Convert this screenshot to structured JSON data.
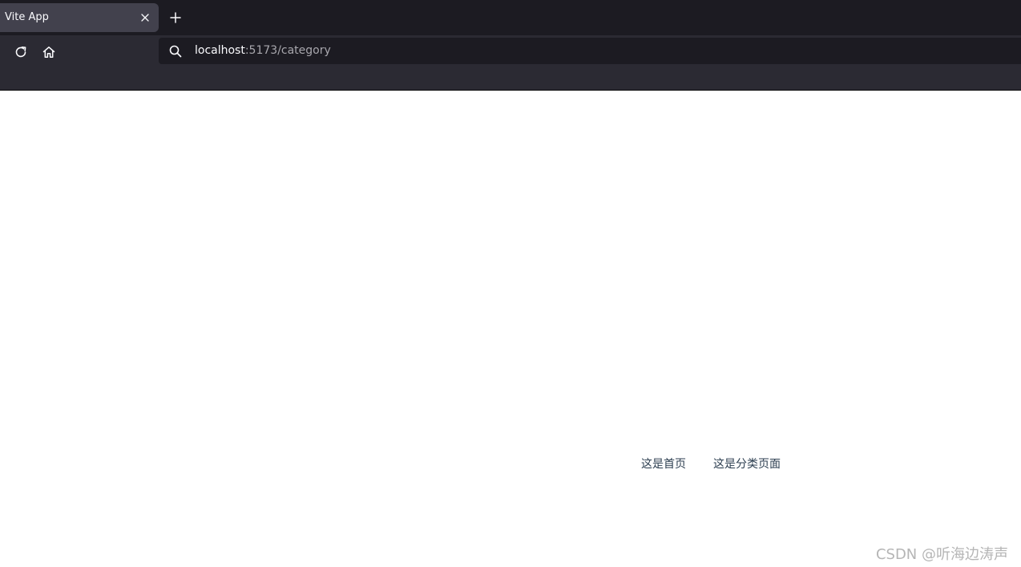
{
  "browser": {
    "tab": {
      "title": "Vite App"
    },
    "urlbar": {
      "host": "localhost",
      "rest": ":5173/category"
    },
    "icons": {
      "tab_close": "close-icon",
      "new_tab": "plus-icon",
      "reload": "reload-icon",
      "home": "home-icon",
      "search": "search-icon"
    },
    "colors": {
      "tab_strip": "#1c1b22",
      "toolbar": "#2b2a33",
      "active_tab": "#42414d",
      "urlbar": "#1c1b22"
    }
  },
  "page": {
    "nav": {
      "home_link": "这是首页",
      "category_link": "这是分类页面"
    },
    "colors": {
      "link_text": "#2c3e50"
    }
  },
  "watermark": {
    "text": "CSDN @听海边涛声"
  }
}
